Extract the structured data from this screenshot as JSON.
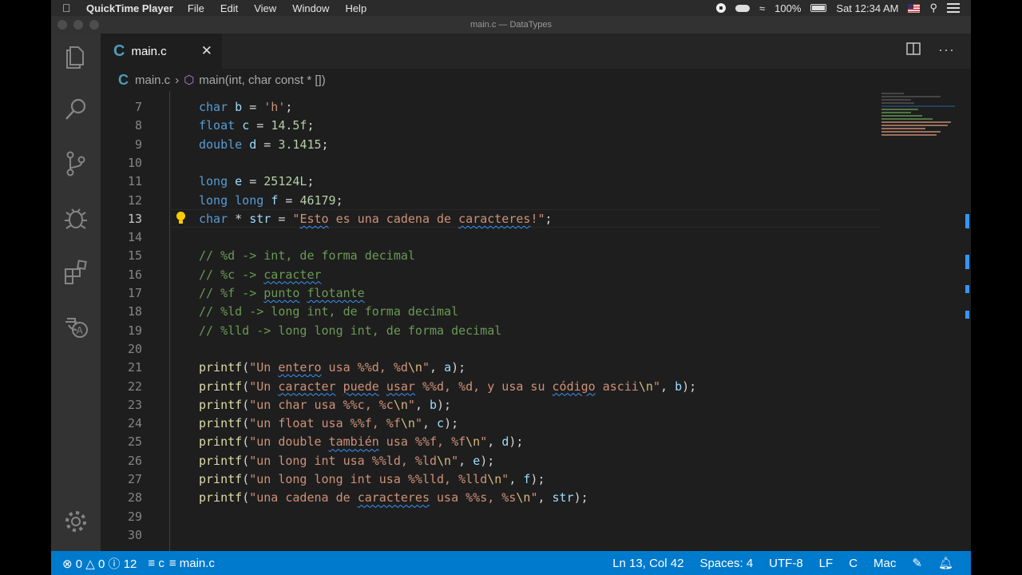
{
  "menubar": {
    "app_name": "QuickTime Player",
    "items": [
      "File",
      "Edit",
      "View",
      "Window",
      "Help"
    ],
    "battery": "100%",
    "clock": "Sat 12:34 AM"
  },
  "window": {
    "title": "main.c — DataTypes"
  },
  "tab": {
    "label": "main.c",
    "lang_icon": "C"
  },
  "breadcrumb": {
    "file": "main.c",
    "symbol": "main(int, char const * [])"
  },
  "editor": {
    "lines": [
      {
        "n": "7",
        "html": "<span class=\"kw\">char</span> <span class=\"id\">b</span><span class=\"pl\"> = </span><span class=\"str\">'h'</span><span class=\"pl\">;</span>"
      },
      {
        "n": "8",
        "html": "<span class=\"kw\">float</span> <span class=\"id\">c</span><span class=\"pl\"> = </span><span class=\"num\">14.5f</span><span class=\"pl\">;</span>"
      },
      {
        "n": "9",
        "html": "<span class=\"kw\">double</span> <span class=\"id\">d</span><span class=\"pl\"> = </span><span class=\"num\">3.1415</span><span class=\"pl\">;</span>"
      },
      {
        "n": "10",
        "html": ""
      },
      {
        "n": "11",
        "html": "<span class=\"kw\">long</span> <span class=\"id\">e</span><span class=\"pl\"> = </span><span class=\"num\">25124L</span><span class=\"pl\">;</span>"
      },
      {
        "n": "12",
        "html": "<span class=\"kw\">long long</span> <span class=\"id\">f</span><span class=\"pl\"> = </span><span class=\"num\">46179</span><span class=\"pl\">;</span>"
      },
      {
        "n": "13",
        "html": "<span class=\"kw\">char</span><span class=\"pl\"> * </span><span class=\"id\">str</span><span class=\"pl\"> = </span><span class=\"str\">\"<span class=\"sq\">Esto</span> es una cadena de <span class=\"sq\">caracteres</span>!\"</span><span class=\"pl\">;</span>",
        "active": true
      },
      {
        "n": "14",
        "html": ""
      },
      {
        "n": "15",
        "html": "<span class=\"cm\">// %d -&gt; int, de forma decimal</span>"
      },
      {
        "n": "16",
        "html": "<span class=\"cm\">// %c -&gt; <span class=\"sq\">caracter</span></span>"
      },
      {
        "n": "17",
        "html": "<span class=\"cm\">// %f -&gt; <span class=\"sq\">punto</span> <span class=\"sq\">flotante</span></span>"
      },
      {
        "n": "18",
        "html": "<span class=\"cm\">// %ld -&gt; long int, de forma decimal</span>"
      },
      {
        "n": "19",
        "html": "<span class=\"cm\">// %lld -&gt; long long int, de forma decimal</span>"
      },
      {
        "n": "20",
        "html": ""
      },
      {
        "n": "21",
        "html": "<span class=\"fn\">printf</span><span class=\"pl\">(</span><span class=\"str\">\"Un <span class=\"sq\">entero</span> usa %%d, %d<span class=\"esc\">\\n</span>\"</span><span class=\"pl\">, </span><span class=\"id\">a</span><span class=\"pl\">);</span>"
      },
      {
        "n": "22",
        "html": "<span class=\"fn\">printf</span><span class=\"pl\">(</span><span class=\"str\">\"Un <span class=\"sq\">caracter</span> <span class=\"sq\">puede</span> <span class=\"sq\">usar</span> %%d, %d, y usa su <span class=\"sq\">código</span> ascii<span class=\"esc\">\\n</span>\"</span><span class=\"pl\">, </span><span class=\"id\">b</span><span class=\"pl\">);</span>"
      },
      {
        "n": "23",
        "html": "<span class=\"fn\">printf</span><span class=\"pl\">(</span><span class=\"str\">\"un char usa %%c, %c<span class=\"esc\">\\n</span>\"</span><span class=\"pl\">, </span><span class=\"id\">b</span><span class=\"pl\">);</span>"
      },
      {
        "n": "24",
        "html": "<span class=\"fn\">printf</span><span class=\"pl\">(</span><span class=\"str\">\"un float usa %%f, %f<span class=\"esc\">\\n</span>\"</span><span class=\"pl\">, </span><span class=\"id\">c</span><span class=\"pl\">);</span>"
      },
      {
        "n": "25",
        "html": "<span class=\"fn\">printf</span><span class=\"pl\">(</span><span class=\"str\">\"un double <span class=\"sq\">también</span> usa %%f, %f<span class=\"esc\">\\n</span>\"</span><span class=\"pl\">, </span><span class=\"id\">d</span><span class=\"pl\">);</span>"
      },
      {
        "n": "26",
        "html": "<span class=\"fn\">printf</span><span class=\"pl\">(</span><span class=\"str\">\"un long int usa %%ld, %ld<span class=\"esc\">\\n</span>\"</span><span class=\"pl\">, </span><span class=\"id\">e</span><span class=\"pl\">);</span>"
      },
      {
        "n": "27",
        "html": "<span class=\"fn\">printf</span><span class=\"pl\">(</span><span class=\"str\">\"un long long int usa %%lld, %lld<span class=\"esc\">\\n</span>\"</span><span class=\"pl\">, </span><span class=\"id\">f</span><span class=\"pl\">);</span>"
      },
      {
        "n": "28",
        "html": "<span class=\"fn\">printf</span><span class=\"pl\">(</span><span class=\"str\">\"una cadena de <span class=\"sq\">caracteres</span> usa %%s, %s<span class=\"esc\">\\n</span>\"</span><span class=\"pl\">, </span><span class=\"id\">str</span><span class=\"pl\">);</span>"
      },
      {
        "n": "29",
        "html": ""
      },
      {
        "n": "30",
        "html": ""
      }
    ]
  },
  "statusbar": {
    "errors": "0",
    "warnings": "0",
    "infos": "12",
    "language_scope": "c",
    "file_scope": "main.c",
    "position": "Ln 13, Col 42",
    "spaces": "Spaces: 4",
    "encoding": "UTF-8",
    "eol": "LF",
    "language": "C",
    "config": "Mac"
  },
  "colors": {
    "accent": "#007acc",
    "editor_bg": "#1e1e1e",
    "activity_bg": "#333333"
  }
}
